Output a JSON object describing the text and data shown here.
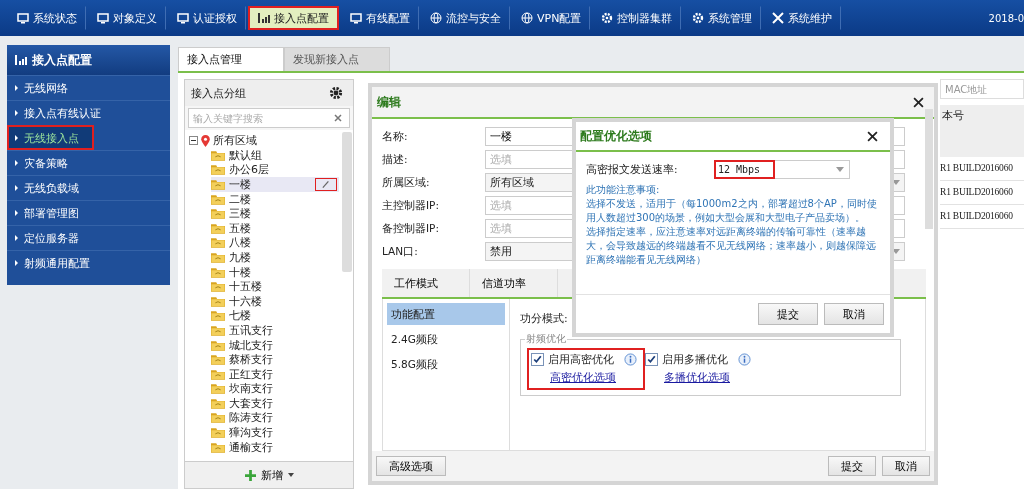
{
  "nav": {
    "tabs": [
      {
        "label": "系统状态",
        "selected": false,
        "highlighted": false
      },
      {
        "label": "对象定义",
        "selected": false,
        "highlighted": false
      },
      {
        "label": "认证授权",
        "selected": false,
        "highlighted": false
      },
      {
        "label": "接入点配置",
        "selected": true,
        "highlighted": true
      },
      {
        "label": "有线配置",
        "selected": false,
        "highlighted": false
      },
      {
        "label": "流控与安全",
        "selected": false,
        "highlighted": false
      },
      {
        "label": "VPN配置",
        "selected": false,
        "highlighted": false
      },
      {
        "label": "控制器集群",
        "selected": false,
        "highlighted": false
      },
      {
        "label": "系统管理",
        "selected": false,
        "highlighted": false
      },
      {
        "label": "系统维护",
        "selected": false,
        "highlighted": false
      }
    ],
    "date": "2018-0"
  },
  "sidebar": {
    "title": "接入点配置",
    "items": [
      {
        "label": "无线网络",
        "selected": false,
        "highlighted": false
      },
      {
        "label": "接入点有线认证",
        "selected": false,
        "highlighted": false
      },
      {
        "label": "无线接入点",
        "selected": true,
        "highlighted": true
      },
      {
        "label": "灾备策略",
        "selected": false,
        "highlighted": false
      },
      {
        "label": "无线负载域",
        "selected": false,
        "highlighted": false
      },
      {
        "label": "部署管理图",
        "selected": false,
        "highlighted": false
      },
      {
        "label": "定位服务器",
        "selected": false,
        "highlighted": false
      },
      {
        "label": "射频通用配置",
        "selected": false,
        "highlighted": false
      }
    ]
  },
  "tabs": [
    {
      "label": "接入点管理",
      "selected": true
    },
    {
      "label": "发现新接入点",
      "selected": false
    }
  ],
  "group_panel": {
    "title": "接入点分组",
    "search": {
      "placeholder": "输入关键字搜索"
    },
    "tree": {
      "label": "所有区域",
      "expanded": true,
      "children": [
        {
          "label": "默认组",
          "selected": false
        },
        {
          "label": "办公6层",
          "selected": false
        },
        {
          "label": "一楼",
          "selected": true
        },
        {
          "label": "二楼",
          "selected": false
        },
        {
          "label": "三楼",
          "selected": false
        },
        {
          "label": "五楼",
          "selected": false
        },
        {
          "label": "八楼",
          "selected": false
        },
        {
          "label": "九楼",
          "selected": false
        },
        {
          "label": "十楼",
          "selected": false
        },
        {
          "label": "十五楼",
          "selected": false
        },
        {
          "label": "十六楼",
          "selected": false
        },
        {
          "label": "七楼",
          "selected": false
        },
        {
          "label": "五讯支行",
          "selected": false
        },
        {
          "label": "城北支行",
          "selected": false
        },
        {
          "label": "蔡桥支行",
          "selected": false
        },
        {
          "label": "正红支行",
          "selected": false
        },
        {
          "label": "坎南支行",
          "selected": false
        },
        {
          "label": "大套支行",
          "selected": false
        },
        {
          "label": "陈涛支行",
          "selected": false
        },
        {
          "label": "獐沟支行",
          "selected": false
        },
        {
          "label": "通榆支行",
          "selected": false
        }
      ]
    },
    "add_button": "新增"
  },
  "ap_table": {
    "search": {
      "placeholder": "MAC地址"
    },
    "column": "本号",
    "rows": [
      "R1 BUILD2016060",
      "R1 BUILD2016060",
      "R1 BUILD2016060"
    ]
  },
  "edit_dialog": {
    "title": "编辑",
    "fields": [
      {
        "label": "名称:",
        "kind": "input",
        "value": "一楼"
      },
      {
        "label": "描述:",
        "kind": "input",
        "placeholder": "选填"
      },
      {
        "label": "所属区域:",
        "kind": "select",
        "value": "所有区域"
      },
      {
        "label": "主控制器IP:",
        "kind": "input",
        "placeholder": "选填"
      },
      {
        "label": "备控制器IP:",
        "kind": "input",
        "placeholder": "选填"
      },
      {
        "label": "LAN口:",
        "kind": "select",
        "value": "禁用"
      }
    ],
    "tabs": [
      {
        "label": "工作模式",
        "selected": false
      },
      {
        "label": "信道功率",
        "selected": false
      }
    ],
    "side_items": [
      {
        "label": "功能配置",
        "selected": true
      },
      {
        "label": "2.4G频段",
        "selected": false
      },
      {
        "label": "5.8G频段",
        "selected": false
      }
    ],
    "mode_label": "功分模式:",
    "group_title": "射频优化",
    "options": [
      {
        "label": "启用高密优化",
        "checked": true,
        "link": "高密优化选项",
        "highlighted": true
      },
      {
        "label": "启用多播优化",
        "checked": true,
        "link": "多播优化选项",
        "highlighted": false
      }
    ],
    "advanced_button": "高级选项",
    "submit_button": "提交",
    "cancel_button": "取消"
  },
  "config_dialog": {
    "title": "配置优化选项",
    "rate_label": "高密报文发送速率:",
    "rate_value": "12 Mbps",
    "rate_highlighted": true,
    "notes": [
      "此功能注意事项:",
      "选择不发送，适用于（每1000m2之内，部署超过8个AP，同时使用人数超过300的场景，例如大型会展和大型电子产品卖场）。",
      "选择指定速率，应注意速率对远距离终端的传输可靠性（速率越大，会导致越远的终端越看不见无线网络；速率越小，则越保障远距离终端能看见无线网络）"
    ],
    "submit_button": "提交",
    "cancel_button": "取消"
  }
}
